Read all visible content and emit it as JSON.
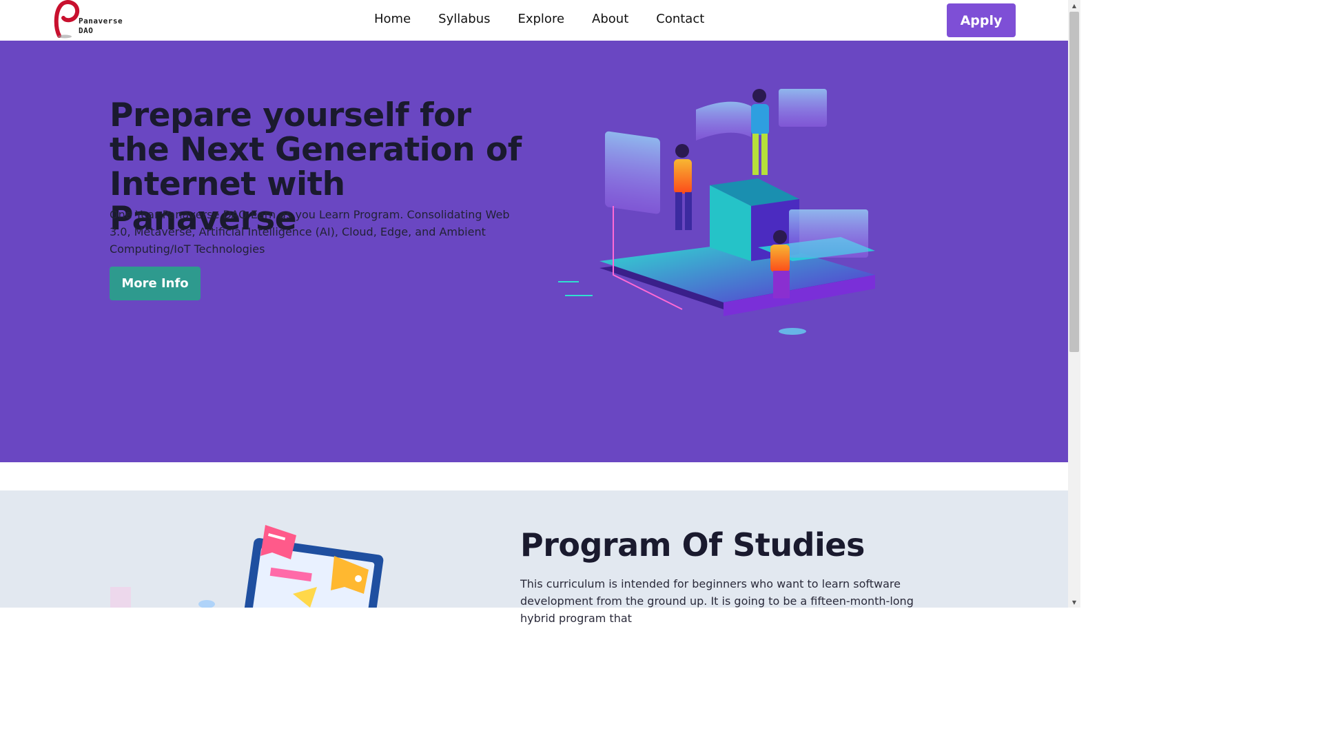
{
  "brand": {
    "name_line1": "Panaverse",
    "name_line2": "DAO",
    "accent": "#c8102e"
  },
  "nav": {
    "links": [
      "Home",
      "Syllabus",
      "Explore",
      "About",
      "Contact"
    ],
    "apply_label": "Apply",
    "apply_color": "#7e4fd6"
  },
  "hero": {
    "title": "Prepare yourself for the Next Generation of Internet with Panaverse",
    "subtitle": "One Year Panaverse DAO Earn as you Learn Program. Consolidating Web 3.0, Metaverse, Artificial Intelligence (AI), Cloud, Edge, and Ambient Computing/IoT Technologies",
    "cta_label": "More Info",
    "background": "#6a47c2",
    "cta_color": "#2e9a8e",
    "illustration": "vr-metaverse-illustration"
  },
  "studies": {
    "title": "Program Of Studies",
    "text": "This curriculum is intended for beginners who want to learn software development from the ground up. It is going to be a fifteen-month-long hybrid program that",
    "background": "#e2e8f0",
    "illustration": "laptop-chat-illustration"
  }
}
